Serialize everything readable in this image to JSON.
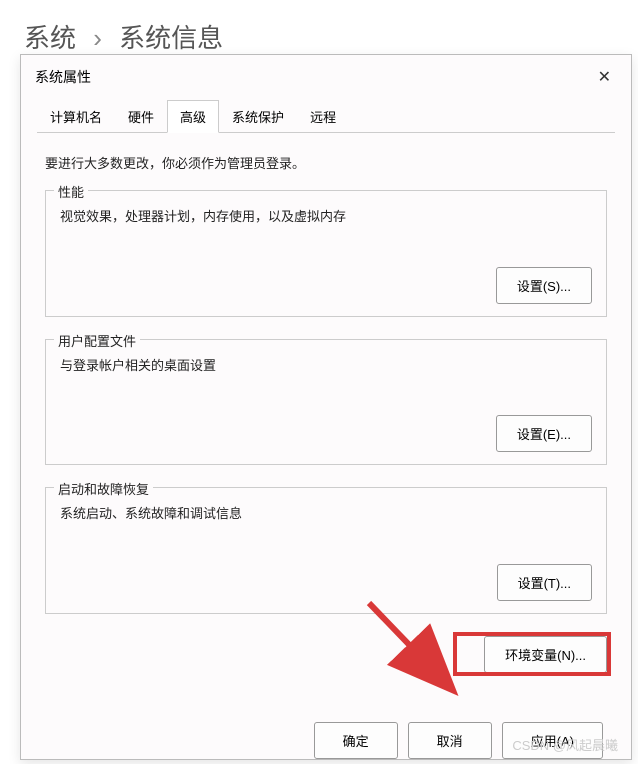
{
  "breadcrumb": {
    "parent": "系统",
    "current": "系统信息"
  },
  "dialog": {
    "title": "系统属性",
    "tabs": [
      "计算机名",
      "硬件",
      "高级",
      "系统保护",
      "远程"
    ],
    "activeTab": "高级",
    "intro": "要进行大多数更改，你必须作为管理员登录。",
    "groups": {
      "perf": {
        "title": "性能",
        "desc": "视觉效果，处理器计划，内存使用，以及虚拟内存",
        "btn": "设置(S)..."
      },
      "profile": {
        "title": "用户配置文件",
        "desc": "与登录帐户相关的桌面设置",
        "btn": "设置(E)..."
      },
      "startup": {
        "title": "启动和故障恢复",
        "desc": "系统启动、系统故障和调试信息",
        "btn": "设置(T)..."
      }
    },
    "envBtn": "环境变量(N)...",
    "footer": {
      "ok": "确定",
      "cancel": "取消",
      "apply": "应用(A)"
    }
  },
  "watermark": "CSDN @风起晨曦"
}
